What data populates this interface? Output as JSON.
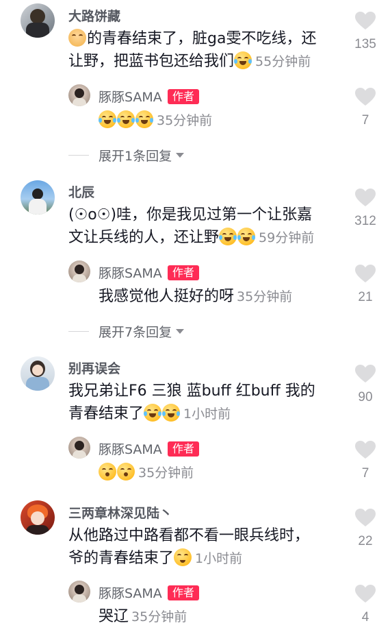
{
  "comments": [
    {
      "name": "大路饼藏",
      "text_line1": "的青春结束了，脏ga雯不吃线，还",
      "text_line2": "让野，把蓝书包还给我们",
      "time": "55分钟前",
      "likes": "135",
      "reply": {
        "name": "豚豚SAMA",
        "badge": "作者",
        "text": "",
        "time": "35分钟前",
        "likes": "7"
      },
      "expand": "展开1条回复"
    },
    {
      "name": "北辰",
      "text_line1": "(☉o☉)哇，你是我见过第一个让张嘉",
      "text_line2": "文让兵线的人，还让野",
      "time": "59分钟前",
      "likes": "312",
      "reply": {
        "name": "豚豚SAMA",
        "badge": "作者",
        "text": "我感觉他人挺好的呀",
        "time": "35分钟前",
        "likes": "21"
      },
      "expand": "展开7条回复"
    },
    {
      "name": "别再误会",
      "text_line1": "我兄弟让F6 三狼 蓝buff 红buff 我的",
      "text_line2": "青春结束了",
      "time": "1小时前",
      "likes": "90",
      "reply": {
        "name": "豚豚SAMA",
        "badge": "作者",
        "text": "",
        "time": "35分钟前",
        "likes": "7"
      }
    },
    {
      "name": "三两章林深见陆丶",
      "text_line1": "从他路过中路看都不看一眼兵线时，",
      "text_line2": "爷的青春结束了",
      "time": "1小时前",
      "likes": "22",
      "reply": {
        "name": "豚豚SAMA",
        "badge": "作者",
        "text": "哭辽",
        "time": "35分钟前",
        "likes": "4"
      }
    }
  ],
  "colors": {
    "accent": "#fe2c55",
    "heart": "#dcdcde",
    "muted": "#8a8b91"
  }
}
